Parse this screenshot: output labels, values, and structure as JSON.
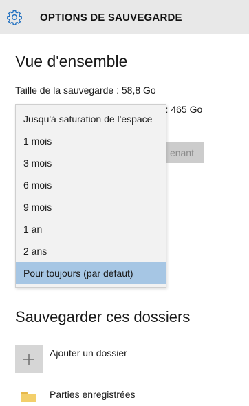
{
  "header": {
    "icon": "gear-icon",
    "title": "OPTIONS DE SAUVEGARDE",
    "accent_color": "#1f6fc0"
  },
  "overview": {
    "heading": "Vue d'ensemble",
    "backup_size": "Taille de la sauvegarde : 58,8 Go",
    "total_space_fragment": ") : 465 Go",
    "backup_now_fragment": "enant"
  },
  "keep_backups_dropdown": {
    "options": [
      "Jusqu'à saturation de l'espace",
      "1 mois",
      "3 mois",
      "6 mois",
      "9 mois",
      "1 an",
      "2 ans",
      "Pour toujours (par défaut)"
    ],
    "selected": "Pour toujours (par défaut)",
    "selected_color": "#a6c6e4"
  },
  "folders": {
    "heading": "Sauvegarder ces dossiers",
    "add_folder_label": "Ajouter un dossier",
    "add_folder_icon": "plus-icon",
    "items": [
      {
        "label": "Parties enregistrées",
        "icon": "folder-icon"
      }
    ]
  }
}
